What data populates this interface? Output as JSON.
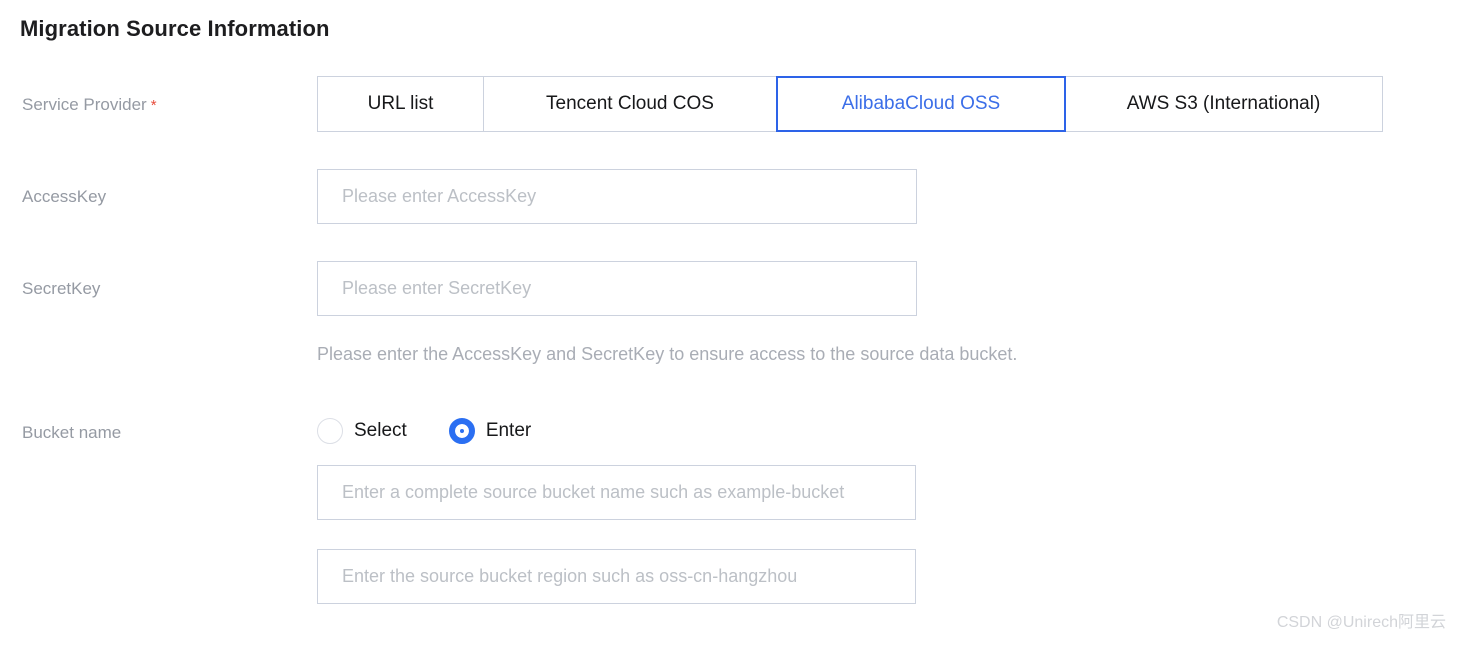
{
  "header": {
    "title": "Migration Source Information"
  },
  "form": {
    "service_provider": {
      "label": "Service Provider",
      "required_mark": "*",
      "selected": "AlibabaCloud OSS",
      "tabs": [
        {
          "label": "URL list",
          "active": false
        },
        {
          "label": "Tencent Cloud COS",
          "active": false
        },
        {
          "label": "AlibabaCloud OSS",
          "active": true
        },
        {
          "label": "AWS S3 (International)",
          "active": false
        }
      ]
    },
    "access_key": {
      "label": "AccessKey",
      "placeholder": "Please enter AccessKey",
      "value": ""
    },
    "secret_key": {
      "label": "SecretKey",
      "placeholder": "Please enter SecretKey",
      "value": ""
    },
    "keys_hint": "Please enter the AccessKey and SecretKey to ensure access to the source data bucket.",
    "bucket_name": {
      "label": "Bucket name",
      "selected_mode": "Enter",
      "options": [
        {
          "label": "Select",
          "checked": false
        },
        {
          "label": "Enter",
          "checked": true
        }
      ],
      "bucket_input": {
        "placeholder": "Enter a complete source bucket name such as example-bucket",
        "value": ""
      },
      "region_input": {
        "placeholder": "Enter the source bucket region such as oss-cn-hangzhou",
        "value": ""
      }
    }
  },
  "watermark": "CSDN @Unirech阿里云",
  "colors": {
    "accent_blue": "#2d63e8",
    "active_tab_text": "#3b6ee8",
    "radio_blue": "#2b6ff2",
    "required_red": "#e74c3c",
    "label_gray": "#959aa3",
    "placeholder_gray": "#bcc0c6",
    "border_gray": "#ccd2de",
    "title_black": "#1d1d1f"
  }
}
